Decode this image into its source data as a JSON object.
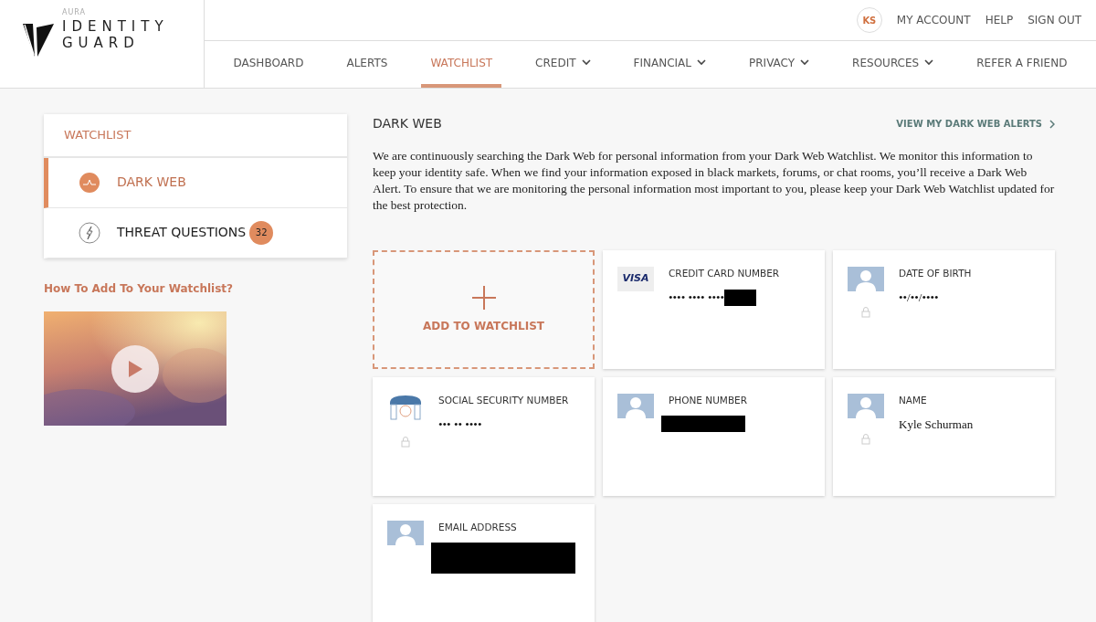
{
  "logo": {
    "brand": "AURA",
    "line_1": "IDENTITY",
    "line_2": "GUARD"
  },
  "account": {
    "initials": "KS",
    "links": [
      "MY ACCOUNT",
      "HELP",
      "SIGN OUT"
    ]
  },
  "nav": [
    {
      "label": "DASHBOARD",
      "selected": false,
      "dropdown": false
    },
    {
      "label": "ALERTS",
      "selected": false,
      "dropdown": false
    },
    {
      "label": "WATCHLIST",
      "selected": true,
      "dropdown": false
    },
    {
      "label": "CREDIT",
      "selected": false,
      "dropdown": true
    },
    {
      "label": "FINANCIAL",
      "selected": false,
      "dropdown": true
    },
    {
      "label": "PRIVACY",
      "selected": false,
      "dropdown": true
    },
    {
      "label": "RESOURCES",
      "selected": false,
      "dropdown": true
    },
    {
      "label": "REFER A FRIEND",
      "selected": false,
      "dropdown": false
    }
  ],
  "sidebar": {
    "title": "WATCHLIST",
    "items": [
      {
        "label": "DARK WEB",
        "kind": "darkweb",
        "selected": true
      },
      {
        "label": "THREAT QUESTIONS",
        "kind": "threat",
        "selected": false,
        "count": "32"
      }
    ],
    "help_link": "How To Add To Your Watchlist?"
  },
  "section": {
    "title": "DARK WEB",
    "link": "VIEW MY DARK WEB ALERTS",
    "description": "We are continuously searching the Dark Web for personal information from your Dark Web Watchlist. We monitor this information to keep your identity safe. When we find your information exposed in black markets, forums, or chat rooms, you’ll receive a Dark Web Alert. To ensure that we are monitoring the personal information most important to you, please keep your Dark Web Watchlist updated for the best protection."
  },
  "add_card": {
    "label": "ADD TO WATCHLIST"
  },
  "cards": [
    {
      "label": "CREDIT CARD NUMBER",
      "kind": "visa",
      "icon_text": "VISA",
      "locked": false,
      "value": "•••• •••• ••••",
      "redacted": true
    },
    {
      "label": "DATE OF BIRTH",
      "kind": "person",
      "locked": true,
      "value": "••/••/••••",
      "redacted": false
    },
    {
      "label": "SOCIAL SECURITY NUMBER",
      "kind": "phone",
      "locked": true,
      "value": "••• •• ••••",
      "redacted": false
    },
    {
      "label": "PHONE NUMBER",
      "kind": "person",
      "locked": false,
      "redacted": true
    },
    {
      "label": "NAME",
      "kind": "person",
      "locked": true,
      "value": "Kyle Schurman",
      "redacted": false
    },
    {
      "label": "EMAIL ADDRESS",
      "kind": "person",
      "locked": false,
      "redacted": true
    }
  ]
}
